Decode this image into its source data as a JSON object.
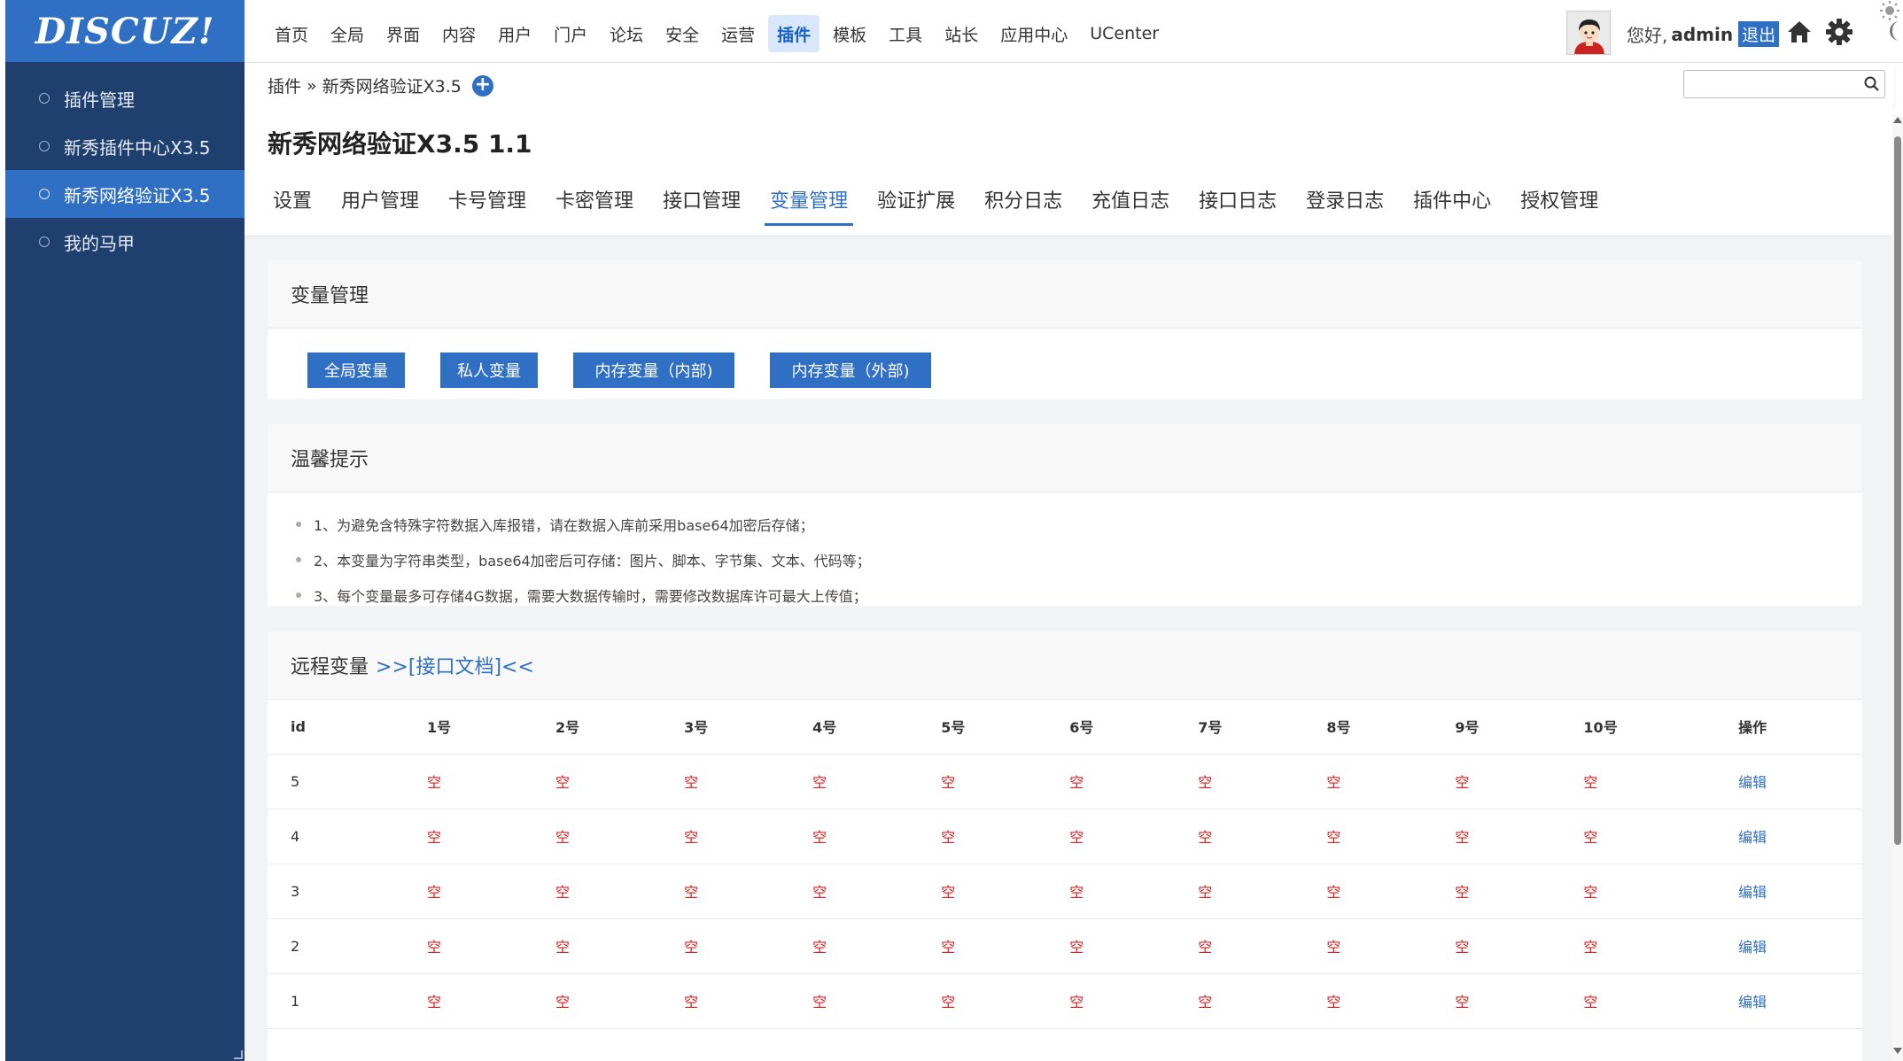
{
  "app": {
    "logo_text": "DISCUZ!"
  },
  "sidebar": {
    "items": [
      {
        "label": "插件管理",
        "active": false
      },
      {
        "label": "新秀插件中心X3.5",
        "active": false
      },
      {
        "label": "新秀网络验证X3.5",
        "active": true
      },
      {
        "label": "我的马甲",
        "active": false
      }
    ]
  },
  "topnav": {
    "items": [
      "首页",
      "全局",
      "界面",
      "内容",
      "用户",
      "门户",
      "论坛",
      "安全",
      "运营",
      "插件",
      "模板",
      "工具",
      "站长",
      "应用中心",
      "UCenter"
    ],
    "active": "插件",
    "greeting": "您好,",
    "username": "admin",
    "logout": "退出"
  },
  "breadcrumb": {
    "root": "插件",
    "sep": "»",
    "current": "新秀网络验证X3.5",
    "add_icon": "plus-circle-icon"
  },
  "search": {
    "placeholder": "",
    "value": ""
  },
  "plugin": {
    "title": "新秀网络验证X3.5 1.1",
    "tabs": [
      "设置",
      "用户管理",
      "卡号管理",
      "卡密管理",
      "接口管理",
      "变量管理",
      "验证扩展",
      "积分日志",
      "充值日志",
      "接口日志",
      "登录日志",
      "插件中心",
      "授权管理"
    ],
    "active_tab": "变量管理"
  },
  "variables_panel": {
    "title": "变量管理",
    "buttons": [
      "全局变量",
      "私人变量",
      "内存变量（内部)",
      "内存变量（外部)"
    ]
  },
  "tips_panel": {
    "title": "温馨提示",
    "tips": [
      "1、为避免含特殊字符数据入库报错，请在数据入库前采用base64加密后存储；",
      "2、本变量为字符串类型，base64加密后可存储：图片、脚本、字节集、文本、代码等；",
      "3、每个变量最多可存储4G数据，需要大数据传输时，需要修改数据库许可最大上传值；"
    ]
  },
  "remote_panel": {
    "title": "远程变量",
    "doc_link": ">>[接口文档]<<",
    "columns": [
      "id",
      "1号",
      "2号",
      "3号",
      "4号",
      "5号",
      "6号",
      "7号",
      "8号",
      "9号",
      "10号",
      "操作"
    ],
    "rows": [
      {
        "id": "5",
        "cells": [
          "空",
          "空",
          "空",
          "空",
          "空",
          "空",
          "空",
          "空",
          "空",
          "空"
        ],
        "action": "编辑"
      },
      {
        "id": "4",
        "cells": [
          "空",
          "空",
          "空",
          "空",
          "空",
          "空",
          "空",
          "空",
          "空",
          "空"
        ],
        "action": "编辑"
      },
      {
        "id": "3",
        "cells": [
          "空",
          "空",
          "空",
          "空",
          "空",
          "空",
          "空",
          "空",
          "空",
          "空"
        ],
        "action": "编辑"
      },
      {
        "id": "2",
        "cells": [
          "空",
          "空",
          "空",
          "空",
          "空",
          "空",
          "空",
          "空",
          "空",
          "空"
        ],
        "action": "编辑"
      },
      {
        "id": "1",
        "cells": [
          "空",
          "空",
          "空",
          "空",
          "空",
          "空",
          "空",
          "空",
          "空",
          "空"
        ],
        "action": "编辑"
      }
    ]
  },
  "colors": {
    "accent": "#2f6fc4",
    "sidebar": "#1f3f6e",
    "empty_text": "#e02020"
  }
}
